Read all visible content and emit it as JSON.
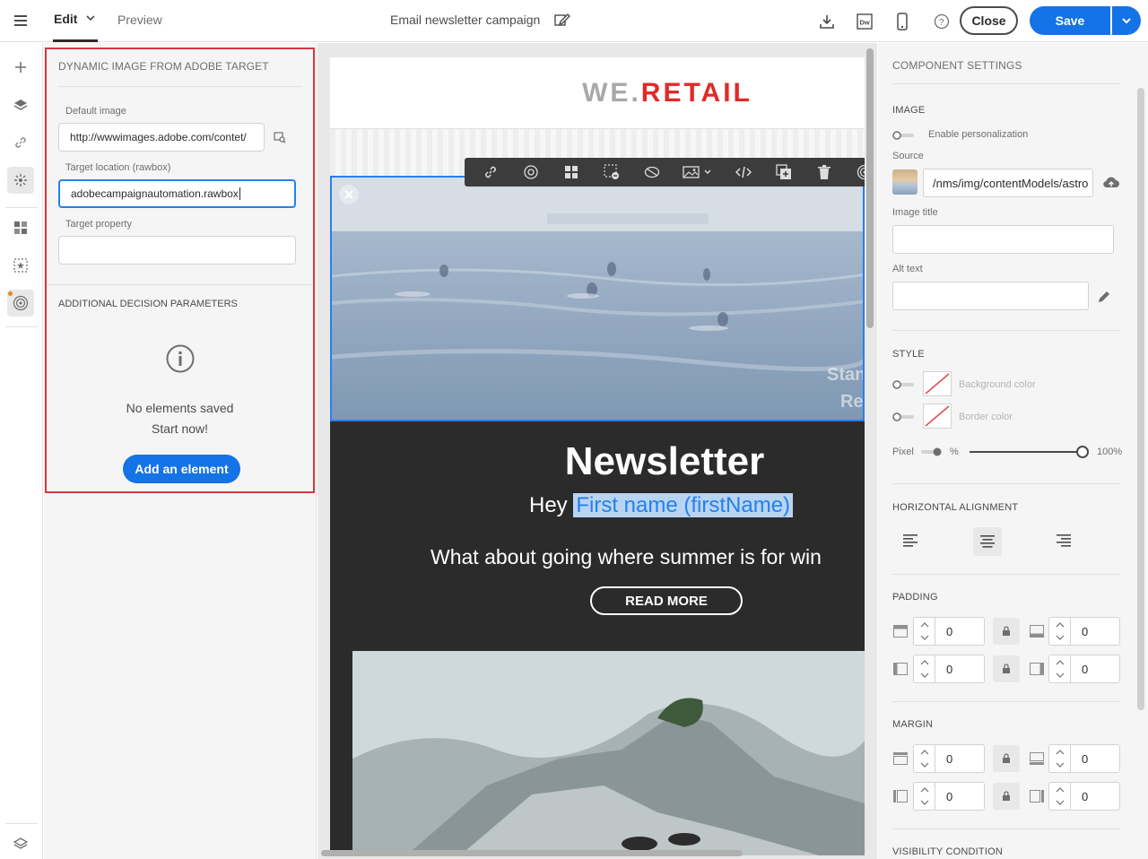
{
  "topbar": {
    "tab_edit": "Edit",
    "tab_preview": "Preview",
    "title": "Email newsletter campaign",
    "close_label": "Close",
    "save_label": "Save",
    "dw_badge": "Dw"
  },
  "left_panel": {
    "heading": "DYNAMIC IMAGE FROM ADOBE TARGET",
    "default_image_label": "Default image",
    "default_image_value": "http://wwwimages.adobe.com/contet/",
    "target_location_label": "Target location (rawbox)",
    "target_location_value": "adobecampaignautomation.rawbox",
    "target_property_label": "Target property",
    "target_property_value": "",
    "decision_heading": "ADDITIONAL DECISION PARAMETERS",
    "empty_line1": "No elements saved",
    "empty_line2": "Start now!",
    "add_button": "Add an element"
  },
  "email": {
    "logo_we": "WE",
    "logo_dot": ".",
    "logo_retail": "RETAIL",
    "hero_overlay_text": "Stan\nRe",
    "newsletter_title": "Newsletter",
    "hey": "Hey",
    "first_name": "First name (firstName)",
    "tagline": "What about going where summer is for win",
    "read_more": "READ MORE"
  },
  "right_panel": {
    "heading": "COMPONENT SETTINGS",
    "image_section": "IMAGE",
    "enable_personalization": "Enable personalization",
    "source_label": "Source",
    "source_value": "/nms/img/contentModels/astro",
    "image_title_label": "Image title",
    "image_title_value": "",
    "alt_text_label": "Alt text",
    "alt_text_value": "",
    "style_section": "STYLE",
    "background_color": "Background color",
    "border_color": "Border color",
    "pixel_label": "Pixel",
    "percent_label": "%",
    "opacity_value": "100%",
    "horizontal_alignment": "HORIZONTAL ALIGNMENT",
    "padding_section": "PADDING",
    "padding_values": [
      "0",
      "0",
      "0",
      "0"
    ],
    "margin_section": "MARGIN",
    "margin_values": [
      "0",
      "0",
      "0",
      "0"
    ],
    "visibility_section": "VISIBILITY CONDITION"
  },
  "colors": {
    "accent": "#1473e6",
    "highlight_border": "#d7373f",
    "logo_red": "#e02a2a"
  }
}
